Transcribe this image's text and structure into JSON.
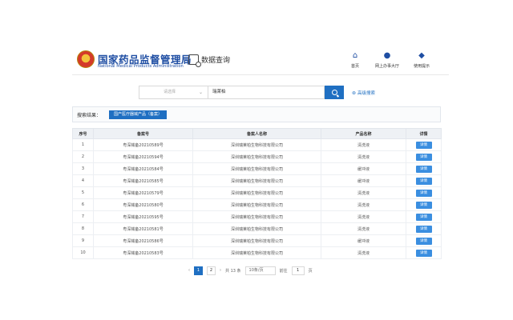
{
  "header": {
    "brand_cn": "国家药品监督管理局",
    "brand_en": "National Medical Products Administration",
    "data_query": "数据查询",
    "nav": [
      {
        "label": "首页",
        "icon": "home-icon"
      },
      {
        "label": "网上办事大厅",
        "icon": "user-icon"
      },
      {
        "label": "使用提示",
        "icon": "tips-icon"
      }
    ]
  },
  "search": {
    "select_placeholder": "请选择",
    "query": "瑞莱柏",
    "advanced": "高级搜索"
  },
  "results": {
    "label": "搜索结果：",
    "tab": "国产医疗器械产品（备案）"
  },
  "table": {
    "columns": [
      "序号",
      "备案号",
      "备案人名称",
      "产品名称",
      "详情"
    ],
    "detail_label": "详情",
    "rows": [
      {
        "no": "1",
        "record": "粤深械备20210589号",
        "applicant": "深圳瑞莱柏生物科技有限公司",
        "product": "清洗液"
      },
      {
        "no": "2",
        "record": "粤深械备20210594号",
        "applicant": "深圳瑞莱柏生物科技有限公司",
        "product": "清洗液"
      },
      {
        "no": "3",
        "record": "粤深械备20210584号",
        "applicant": "深圳瑞莱柏生物科技有限公司",
        "product": "缓冲液"
      },
      {
        "no": "4",
        "record": "粤深械备20210585号",
        "applicant": "深圳瑞莱柏生物科技有限公司",
        "product": "缓冲液"
      },
      {
        "no": "5",
        "record": "粤深械备20210579号",
        "applicant": "深圳瑞莱柏生物科技有限公司",
        "product": "清洗液"
      },
      {
        "no": "6",
        "record": "粤深械备20210580号",
        "applicant": "深圳瑞莱柏生物科技有限公司",
        "product": "清洗液"
      },
      {
        "no": "7",
        "record": "粤深械备20210595号",
        "applicant": "深圳瑞莱柏生物科技有限公司",
        "product": "清洗液"
      },
      {
        "no": "8",
        "record": "粤深械备20210581号",
        "applicant": "深圳瑞莱柏生物科技有限公司",
        "product": "清洗液"
      },
      {
        "no": "9",
        "record": "粤深械备20210586号",
        "applicant": "深圳瑞莱柏生物科技有限公司",
        "product": "缓冲液"
      },
      {
        "no": "10",
        "record": "粤深械备20210583号",
        "applicant": "深圳瑞莱柏生物科技有限公司",
        "product": "清洗液"
      }
    ]
  },
  "pagination": {
    "prev": "‹",
    "pages": [
      "1",
      "2"
    ],
    "next": "›",
    "total": "共 13 条",
    "page_size": "10条/页",
    "goto_label": "前往",
    "goto_value": "1",
    "page_unit": "页"
  }
}
